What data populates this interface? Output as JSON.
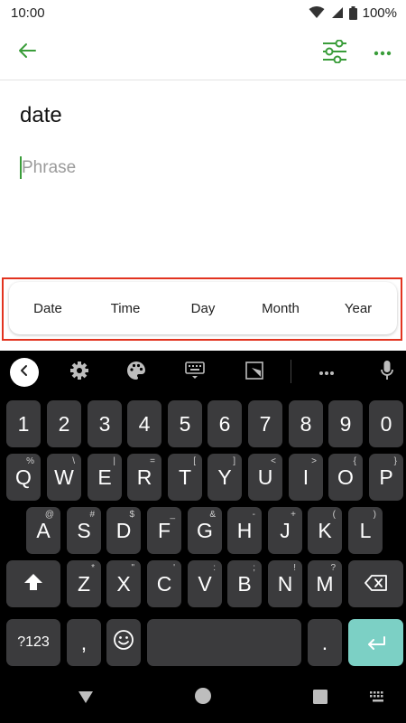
{
  "status": {
    "time": "10:00",
    "battery": "100%"
  },
  "entry": {
    "title": "date",
    "placeholder": "Phrase"
  },
  "suggestions": [
    "Date",
    "Time",
    "Day",
    "Month",
    "Year"
  ],
  "keyboard": {
    "row_numbers": [
      "1",
      "2",
      "3",
      "4",
      "5",
      "6",
      "7",
      "8",
      "9",
      "0"
    ],
    "row_top": [
      [
        "Q",
        "%"
      ],
      [
        "W",
        "\\"
      ],
      [
        "E",
        "|"
      ],
      [
        "R",
        "="
      ],
      [
        "T",
        "["
      ],
      [
        "Y",
        "]"
      ],
      [
        "U",
        "<"
      ],
      [
        "I",
        ">"
      ],
      [
        "O",
        "{"
      ],
      [
        "P",
        "}"
      ]
    ],
    "row_middle": [
      [
        "A",
        "@"
      ],
      [
        "S",
        "#"
      ],
      [
        "D",
        "$"
      ],
      [
        "F",
        "_"
      ],
      [
        "G",
        "&"
      ],
      [
        "H",
        "-"
      ],
      [
        "J",
        "+"
      ],
      [
        "K",
        "("
      ],
      [
        "L",
        ")"
      ]
    ],
    "row_bottom": [
      [
        "Z",
        "*"
      ],
      [
        "X",
        "\""
      ],
      [
        "C",
        "'"
      ],
      [
        "V",
        ":"
      ],
      [
        "B",
        ";"
      ],
      [
        "N",
        "!"
      ],
      [
        "M",
        "?"
      ]
    ],
    "symbols_label": "?123",
    "comma": ",",
    "period": "."
  },
  "colors": {
    "accent": "#3a9d3a",
    "highlight_box": "#e2331f",
    "enter_key": "#7cd0c5",
    "key_bg": "#3b3b3d"
  }
}
